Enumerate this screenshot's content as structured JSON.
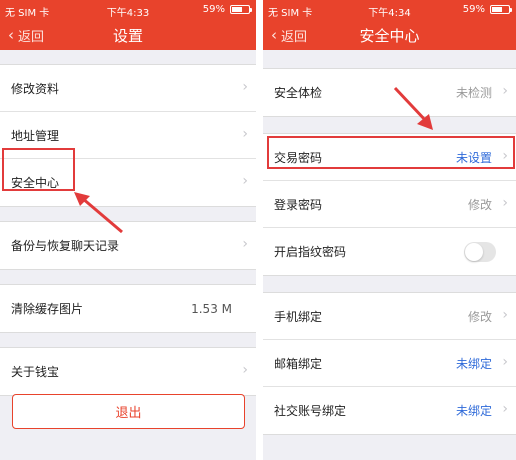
{
  "left": {
    "status": {
      "carrier": "无 SIM 卡",
      "time": "下午4:33",
      "battery": "59%",
      "battery_level": 0.59
    },
    "nav": {
      "back": "返回",
      "title": "设置"
    },
    "groups": [
      {
        "items": [
          {
            "label": "修改资料"
          },
          {
            "label": "地址管理"
          },
          {
            "label": "安全中心"
          }
        ]
      },
      {
        "items": [
          {
            "label": "备份与恢复聊天记录"
          }
        ]
      },
      {
        "items": [
          {
            "label": "清除缓存图片",
            "value": "1.53 M"
          }
        ]
      },
      {
        "items": [
          {
            "label": "关于钱宝"
          }
        ]
      }
    ],
    "logout": "退出"
  },
  "right": {
    "status": {
      "carrier": "无 SIM 卡",
      "time": "下午4:34",
      "battery": "59%",
      "battery_level": 0.59
    },
    "nav": {
      "back": "返回",
      "title": "安全中心"
    },
    "groups": [
      {
        "items": [
          {
            "label": "安全体检",
            "value": "未检测"
          }
        ]
      },
      {
        "items": [
          {
            "label": "交易密码",
            "value": "未设置"
          },
          {
            "label": "登录密码",
            "value": "修改"
          },
          {
            "label": "开启指纹密码",
            "toggle": false
          }
        ]
      },
      {
        "items": [
          {
            "label": "手机绑定",
            "value": "修改"
          },
          {
            "label": "邮箱绑定",
            "value": "未绑定"
          },
          {
            "label": "社交账号绑定",
            "value": "未绑定"
          }
        ]
      }
    ]
  },
  "colors": {
    "accent": "#e8432c",
    "link": "#2e6ad9",
    "highlight": "#e23b3b"
  }
}
